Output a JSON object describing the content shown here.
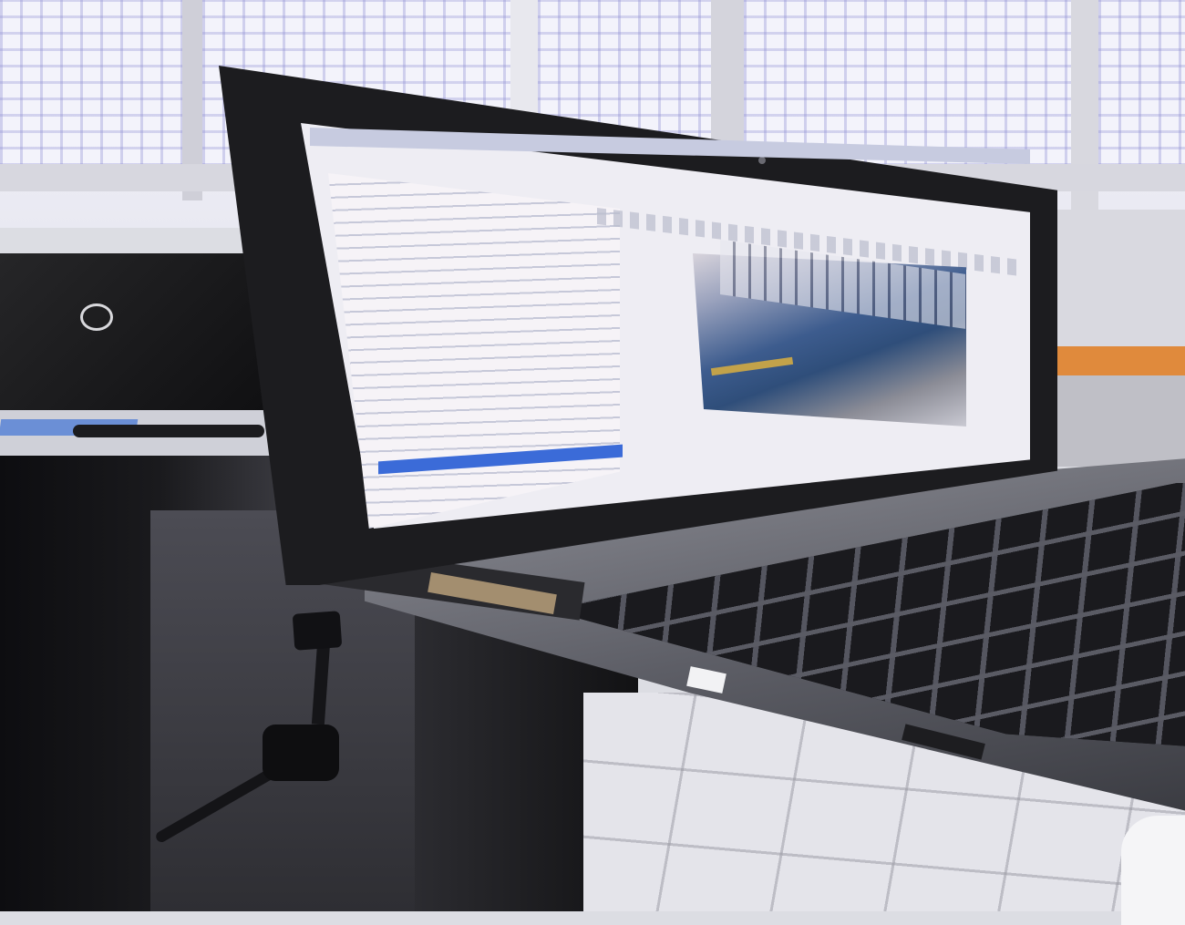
{
  "scene": {
    "description_objects": [],
    "colors": {
      "orange_shelf": "#e08a3c",
      "tree_selection": "#3b6bd8",
      "lid": "#1c1c1f",
      "screen_bg": "#eeedf3"
    },
    "icons": {
      "monitor_logo": "hp-logo-icon",
      "webcam": "webcam-icon"
    }
  }
}
